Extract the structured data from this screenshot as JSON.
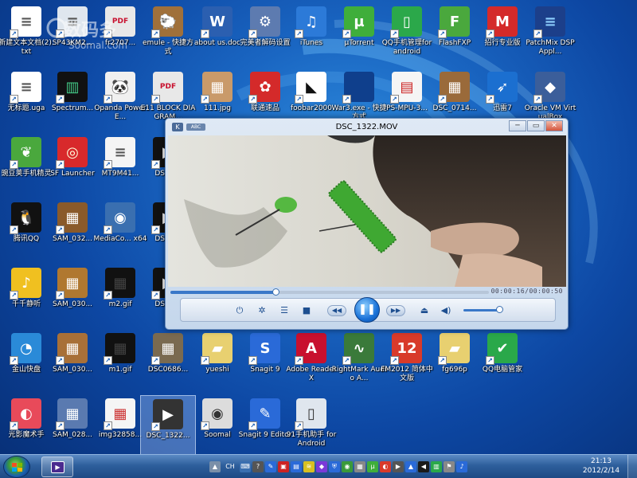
{
  "desktop_icons": [
    {
      "name": "new-text-file-icon",
      "label": "新建文本文档(2).txt",
      "color": "#ffffff",
      "glyph": "≡",
      "fg": "#555"
    },
    {
      "name": "sp-file-icon",
      "label": "SP43KM2...",
      "color": "#dfe6ee",
      "glyph": "≡",
      "fg": "#555"
    },
    {
      "name": "pdf-2707-icon",
      "label": "fr2707...",
      "color": "#e8e8e8",
      "glyph": "PDF",
      "fg": "#c8102e"
    },
    {
      "name": "emule-icon",
      "label": "emule - 快捷方式",
      "color": "#a0703a",
      "glyph": "🐑",
      "fg": "#fff"
    },
    {
      "name": "about-us-doc-icon",
      "label": "about us.doc",
      "color": "#2b5fb0",
      "glyph": "W",
      "fg": "#fff"
    },
    {
      "name": "codec-settings-icon",
      "label": "完美者解码设置",
      "color": "#5d7bb0",
      "glyph": "⚙",
      "fg": "#fff"
    },
    {
      "name": "itunes-icon",
      "label": "iTunes",
      "color": "#2c7ad8",
      "glyph": "♫",
      "fg": "#fff"
    },
    {
      "name": "utorrent-icon",
      "label": "µTorrent",
      "color": "#3fae3b",
      "glyph": "µ",
      "fg": "#fff"
    },
    {
      "name": "qq-phone-manager-icon",
      "label": "QQ手机管理for android",
      "color": "#2ba84a",
      "glyph": "▯",
      "fg": "#fff"
    },
    {
      "name": "flashfxp-icon",
      "label": "FlashFXP",
      "color": "#4aa83d",
      "glyph": "F",
      "fg": "#fff"
    },
    {
      "name": "zhaoxing-icon",
      "label": "招行专业版",
      "color": "#d42a2a",
      "glyph": "M",
      "fg": "#fff"
    },
    {
      "name": "patchmix-icon",
      "label": "PatchMix DSP Appl...",
      "color": "#1c3f8a",
      "glyph": "≡",
      "fg": "#8fd0ff"
    },
    {
      "name": "untitled-uga-icon",
      "label": "无标题.uga",
      "color": "#ffffff",
      "glyph": "≡",
      "fg": "#555"
    },
    {
      "name": "spectrum-icon",
      "label": "Spectrum...",
      "color": "#111111",
      "glyph": "▥",
      "fg": "#4c8"
    },
    {
      "name": "opanda-icon",
      "label": "Opanda PowerE...",
      "color": "#f0f0f0",
      "glyph": "🐼",
      "fg": "#000"
    },
    {
      "name": "e11-block-pdf-icon",
      "label": "E11 BLOCK DIAGRAM...",
      "color": "#e8e8e8",
      "glyph": "PDF",
      "fg": "#c8102e"
    },
    {
      "name": "jpg-111-icon",
      "label": "111.jpg",
      "color": "#c99a6a",
      "glyph": "▦",
      "fg": "#fff"
    },
    {
      "name": "unicom-icon",
      "label": "联通速品",
      "color": "#d42a2a",
      "glyph": "✿",
      "fg": "#fff"
    },
    {
      "name": "foobar2000-icon",
      "label": "foobar2000",
      "color": "#ffffff",
      "glyph": "◣",
      "fg": "#111"
    },
    {
      "name": "war3-icon",
      "label": "War3.exe - 快捷方式",
      "color": "#0f3f8c",
      "glyph": "",
      "fg": "#fff"
    },
    {
      "name": "ps-mpu-icon",
      "label": "PS-MPU-3...",
      "color": "#f5f5f5",
      "glyph": "▤",
      "fg": "#c22"
    },
    {
      "name": "dsc-0714-icon",
      "label": "DSC_0714...",
      "color": "#9a6a3a",
      "glyph": "▦",
      "fg": "#fff"
    },
    {
      "name": "xunlei7-icon",
      "label": "迅雷7",
      "color": "#1b6fd0",
      "glyph": "➶",
      "fg": "#fff"
    },
    {
      "name": "virtualbox-icon",
      "label": "Oracle VM VirtualBox",
      "color": "#3b5e9a",
      "glyph": "◆",
      "fg": "#fff"
    },
    {
      "name": "wandoujia-icon",
      "label": "豌豆荚手机精灵",
      "color": "#4aa83d",
      "glyph": "❦",
      "fg": "#fff"
    },
    {
      "name": "sf-launcher-icon",
      "label": "SF Launcher",
      "color": "#d8292b",
      "glyph": "◎",
      "fg": "#ffd"
    },
    {
      "name": "mt9m41-icon",
      "label": "MT9M41...",
      "color": "#f5f5f5",
      "glyph": "≡",
      "fg": "#555"
    },
    {
      "name": "dsc-video-1-icon",
      "label": "DSC0...",
      "color": "#111111",
      "glyph": "▶",
      "fg": "#fff"
    },
    {
      "name": "qq-icon",
      "label": "腾讯QQ",
      "color": "#111111",
      "glyph": "🐧",
      "fg": "#fff"
    },
    {
      "name": "sam-032-icon",
      "label": "SAM_032...",
      "color": "#8a5a2a",
      "glyph": "▦",
      "fg": "#fff"
    },
    {
      "name": "mediacoder-icon",
      "label": "MediaCo... x64",
      "color": "#3a6fb0",
      "glyph": "◉",
      "fg": "#fff"
    },
    {
      "name": "dsc-video-2-icon",
      "label": "DSC0...",
      "color": "#111111",
      "glyph": "▶",
      "fg": "#fff"
    },
    {
      "name": "ttplayer-icon",
      "label": "千千静听",
      "color": "#f0c020",
      "glyph": "♪",
      "fg": "#fff"
    },
    {
      "name": "sam-030a-icon",
      "label": "SAM_030...",
      "color": "#b07830",
      "glyph": "▦",
      "fg": "#fff"
    },
    {
      "name": "m2-gif-icon",
      "label": "m2.gif",
      "color": "#111111",
      "glyph": "▦",
      "fg": "#444"
    },
    {
      "name": "dsc-video-3-icon",
      "label": "DSC0...",
      "color": "#111111",
      "glyph": "▶",
      "fg": "#fff"
    },
    {
      "name": "kingsoft-icon",
      "label": "金山快盘",
      "color": "#2a8ad8",
      "glyph": "◔",
      "fg": "#fff"
    },
    {
      "name": "sam-030b-icon",
      "label": "SAM_030...",
      "color": "#a87038",
      "glyph": "▦",
      "fg": "#fff"
    },
    {
      "name": "m1-gif-icon",
      "label": "m1.gif",
      "color": "#111111",
      "glyph": "▦",
      "fg": "#444"
    },
    {
      "name": "dsc0686-icon",
      "label": "DSC0686...",
      "color": "#7a6a50",
      "glyph": "▦",
      "fg": "#fff"
    },
    {
      "name": "yueshi-folder-icon",
      "label": "yueshi",
      "color": "#e8d070",
      "glyph": "▰",
      "fg": "#fff"
    },
    {
      "name": "snagit9-icon",
      "label": "Snagit 9",
      "color": "#2a6ad8",
      "glyph": "S",
      "fg": "#fff"
    },
    {
      "name": "adobe-reader-icon",
      "label": "Adobe Reader X",
      "color": "#c8102e",
      "glyph": "A",
      "fg": "#fff"
    },
    {
      "name": "rightmark-icon",
      "label": "RightMark Audio A...",
      "color": "#3a7a3a",
      "glyph": "∿",
      "fg": "#fff"
    },
    {
      "name": "fm2012-icon",
      "label": "FM2012 简体中文版",
      "color": "#d83a2a",
      "glyph": "12",
      "fg": "#fff"
    },
    {
      "name": "fg696p-folder-icon",
      "label": "fg696p",
      "color": "#e8d070",
      "glyph": "▰",
      "fg": "#fff"
    },
    {
      "name": "qq-pc-manager-icon",
      "label": "QQ电脑管家",
      "color": "#2aa84a",
      "glyph": "✔",
      "fg": "#fff"
    },
    {
      "name": "photo-magic-icon",
      "label": "光影魔术手",
      "color": "#e84a5a",
      "glyph": "◐",
      "fg": "#fff"
    },
    {
      "name": "sam-028-icon",
      "label": "SAM_028...",
      "color": "#5a7ab0",
      "glyph": "▦",
      "fg": "#fff"
    },
    {
      "name": "img3285-icon",
      "label": "img32858...",
      "color": "#f5f5f5",
      "glyph": "▦",
      "fg": "#c33"
    },
    {
      "name": "dsc-1322-selected-icon",
      "label": "DSC_1322...",
      "color": "#333333",
      "glyph": "▶",
      "fg": "#fff"
    },
    {
      "name": "soomal-audio-icon",
      "label": "Soomal",
      "color": "#dcdcdc",
      "glyph": "◉",
      "fg": "#333"
    },
    {
      "name": "snagit9-editor-icon",
      "label": "Snagit 9 Editor",
      "color": "#2a6ad8",
      "glyph": "✎",
      "fg": "#fff"
    },
    {
      "name": "phone-assistant-icon",
      "label": "91手机助手 for Android",
      "color": "#dfe6ee",
      "glyph": "▯",
      "fg": "#333"
    }
  ],
  "watermark": {
    "text": "数码多",
    "sub": "Soomal.com"
  },
  "player": {
    "app_label": "ABC",
    "title": "DSC_1322.MOV",
    "timecode": "00:00:16/00:00:50",
    "progress": 0.33,
    "volume": 0.9,
    "btn_min": "─",
    "btn_restore": "▭",
    "btn_close": "✕"
  },
  "taskbar": {
    "lang": "CH",
    "clock_time": "21:13",
    "clock_date": "2012/2/14"
  }
}
